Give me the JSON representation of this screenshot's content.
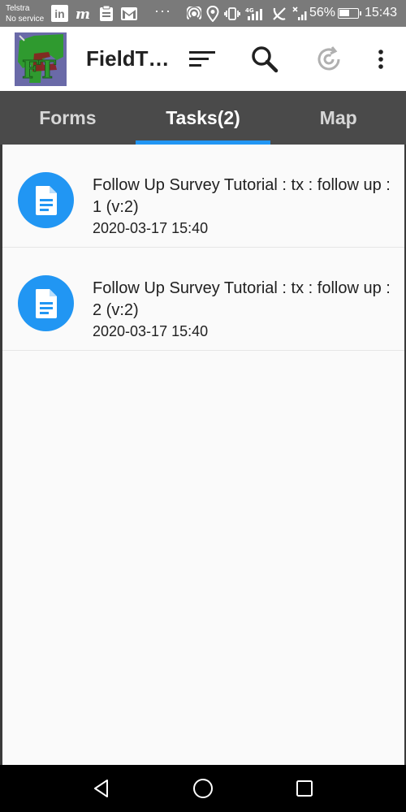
{
  "status_bar": {
    "carrier_line1": "Telstra",
    "carrier_line2": "No service",
    "linkedin_text": "in",
    "battery_percent": "56%",
    "battery_level": 0.56,
    "time": "15:43",
    "overflow": "···",
    "signal_label": "4G"
  },
  "app_bar": {
    "title": "FieldT…",
    "logo_letters": "FT"
  },
  "tabs": [
    {
      "label": "Forms",
      "active": false
    },
    {
      "label": "Tasks(2)",
      "active": true
    },
    {
      "label": "Map",
      "active": false
    }
  ],
  "tasks": [
    {
      "title": "Follow Up Survey Tutorial : tx : follow up : 1 (v:2)",
      "date": "2020-03-17 15:40"
    },
    {
      "title": "Follow Up Survey Tutorial : tx : follow up : 2 (v:2)",
      "date": "2020-03-17 15:40"
    }
  ],
  "colors": {
    "accent": "#2196f3",
    "tab_bar": "#4a4a4a",
    "status_bar": "#7a7a7a"
  }
}
